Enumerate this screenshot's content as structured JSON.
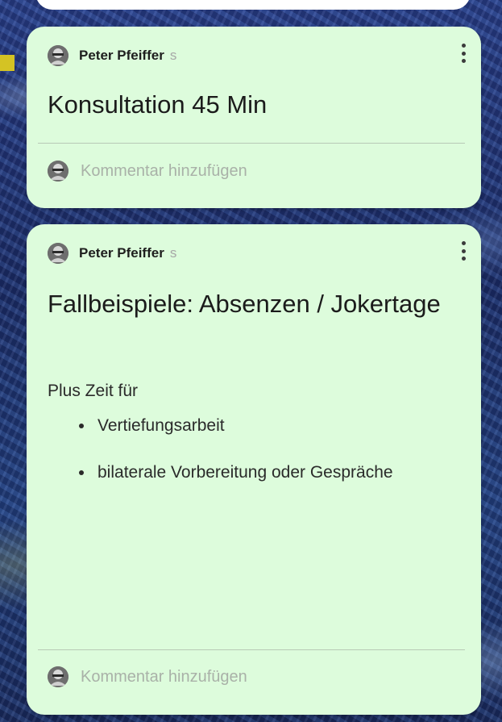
{
  "posts": [
    {
      "author": "Peter Pfeiffer",
      "author_suffix": "s",
      "title": "Konsultation 45 Min",
      "comment_placeholder": "Kommentar hinzufügen"
    },
    {
      "author": "Peter Pfeiffer",
      "author_suffix": "s",
      "title": "Fallbeispiele: Absenzen / Jokertage",
      "body_intro": "Plus Zeit für",
      "body_list": [
        "Vertiefungsarbeit",
        "bilaterale Vorbereitung oder Gespräche"
      ],
      "comment_placeholder": "Kommentar hinzufügen"
    }
  ],
  "colors": {
    "card_background": "#ddfcdc",
    "accent_yellow": "#d4c324",
    "board_background": "#1f2f6e"
  },
  "icons": {
    "avatar": "avatar-icon",
    "menu": "more-vertical-icon"
  }
}
